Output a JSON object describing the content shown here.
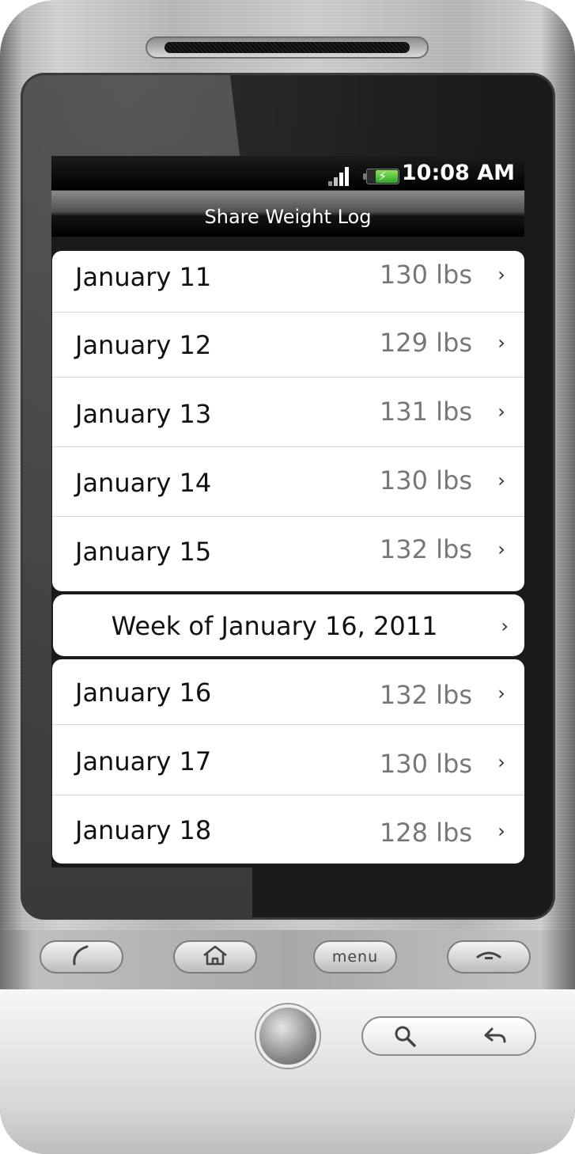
{
  "status_bar": {
    "time": "10:08 AM",
    "signal_icon": "signal-bars-icon",
    "battery_icon": "battery-charging-icon"
  },
  "title_bar": {
    "title": "Share Weight Log"
  },
  "group_1": {
    "rows": [
      {
        "date": "January 11",
        "weight": "130 lbs"
      },
      {
        "date": "January 12",
        "weight": "129 lbs"
      },
      {
        "date": "January 13",
        "weight": "131 lbs"
      },
      {
        "date": "January 14",
        "weight": "130 lbs"
      },
      {
        "date": "January 15",
        "weight": "132 lbs"
      }
    ]
  },
  "week_header": {
    "label": "Week of January 16, 2011"
  },
  "group_2": {
    "rows": [
      {
        "date": "January 16",
        "weight": "132 lbs"
      },
      {
        "date": "January 17",
        "weight": "130 lbs"
      },
      {
        "date": "January 18",
        "weight": "128 lbs"
      }
    ]
  },
  "hardware_buttons": {
    "call_icon": "call-icon",
    "home_icon": "home-icon",
    "menu_label": "menu",
    "end_call_icon": "end-call-icon",
    "search_icon": "search-icon",
    "back_icon": "back-arrow-icon"
  },
  "colors": {
    "screen_bg": "#1a1a1a",
    "row_bg": "#ffffff",
    "weight_text": "#777777",
    "battery_green": "#2fa52c"
  }
}
